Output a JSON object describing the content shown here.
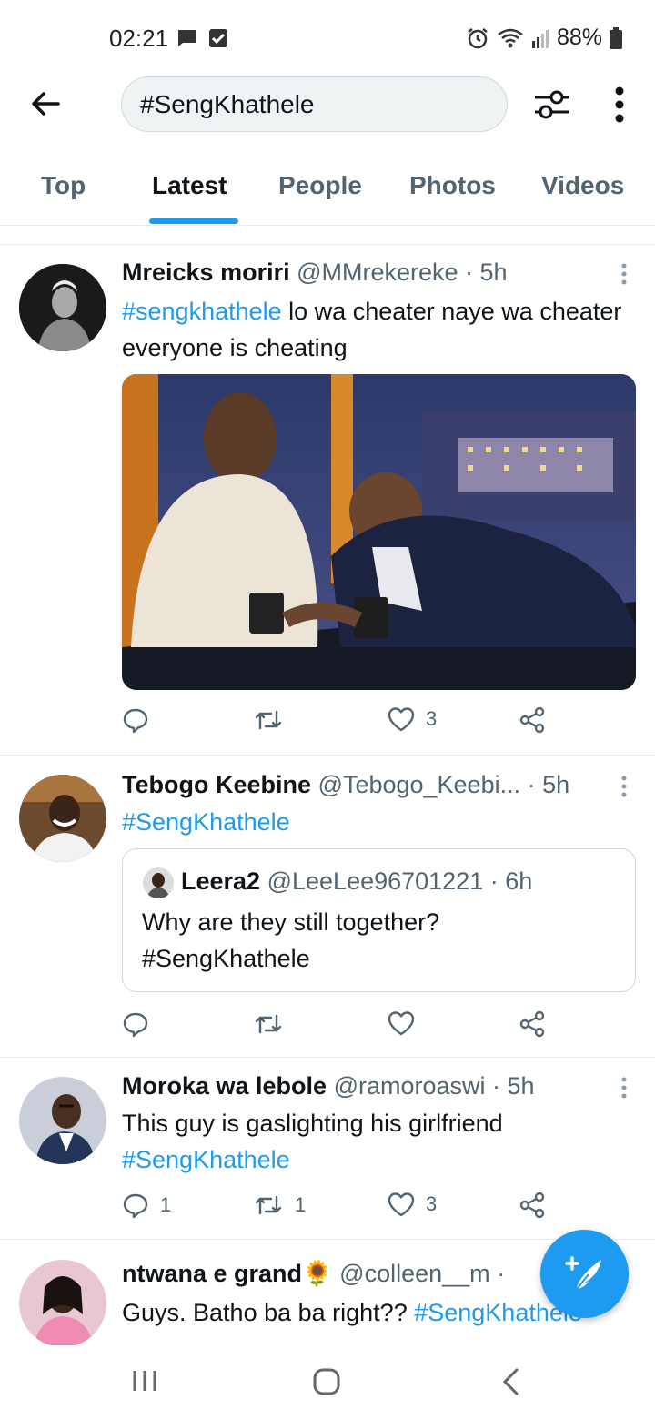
{
  "status_bar": {
    "time": "02:21",
    "battery": "88%"
  },
  "search": {
    "query": "#SengKhathele"
  },
  "tabs": [
    {
      "label": "Top"
    },
    {
      "label": "Latest"
    },
    {
      "label": "People"
    },
    {
      "label": "Photos"
    },
    {
      "label": "Videos"
    }
  ],
  "active_tab": "Latest",
  "tweets": [
    {
      "name": "Mreicks moriri",
      "meta": "@MMrekereke · 5h",
      "hashtag": "#sengkhathele",
      "text": " lo wa cheater naye wa cheater everyone is cheating",
      "actions": {
        "replies": "",
        "retweets": "",
        "likes": "3"
      }
    },
    {
      "name": "Tebogo Keebine",
      "meta": "@Tebogo_Keebi...  · 5h",
      "hashtag": "#SengKhathele",
      "quote": {
        "name": "Leera2",
        "meta": "@LeeLee96701221 · 6h",
        "line1": "Why are they still together?",
        "line2": "#SengKhathele"
      },
      "actions": {
        "replies": "",
        "retweets": "",
        "likes": ""
      }
    },
    {
      "name": "Moroka wa lebole",
      "meta": "@ramoroaswi · 5h",
      "text": "This guy is gaslighting his girlfriend",
      "hashtag": "#SengKhathele",
      "actions": {
        "replies": "1",
        "retweets": "1",
        "likes": "3"
      }
    },
    {
      "name": "ntwana e grand",
      "emoji": "🌻",
      "meta": "@colleen__m ·",
      "text": "Guys. Batho ba ba right?? ",
      "hashtag": "#SengKhathele"
    }
  ],
  "colors": {
    "accent": "#1d9bf0",
    "text": "#0f1419",
    "muted": "#536471"
  }
}
